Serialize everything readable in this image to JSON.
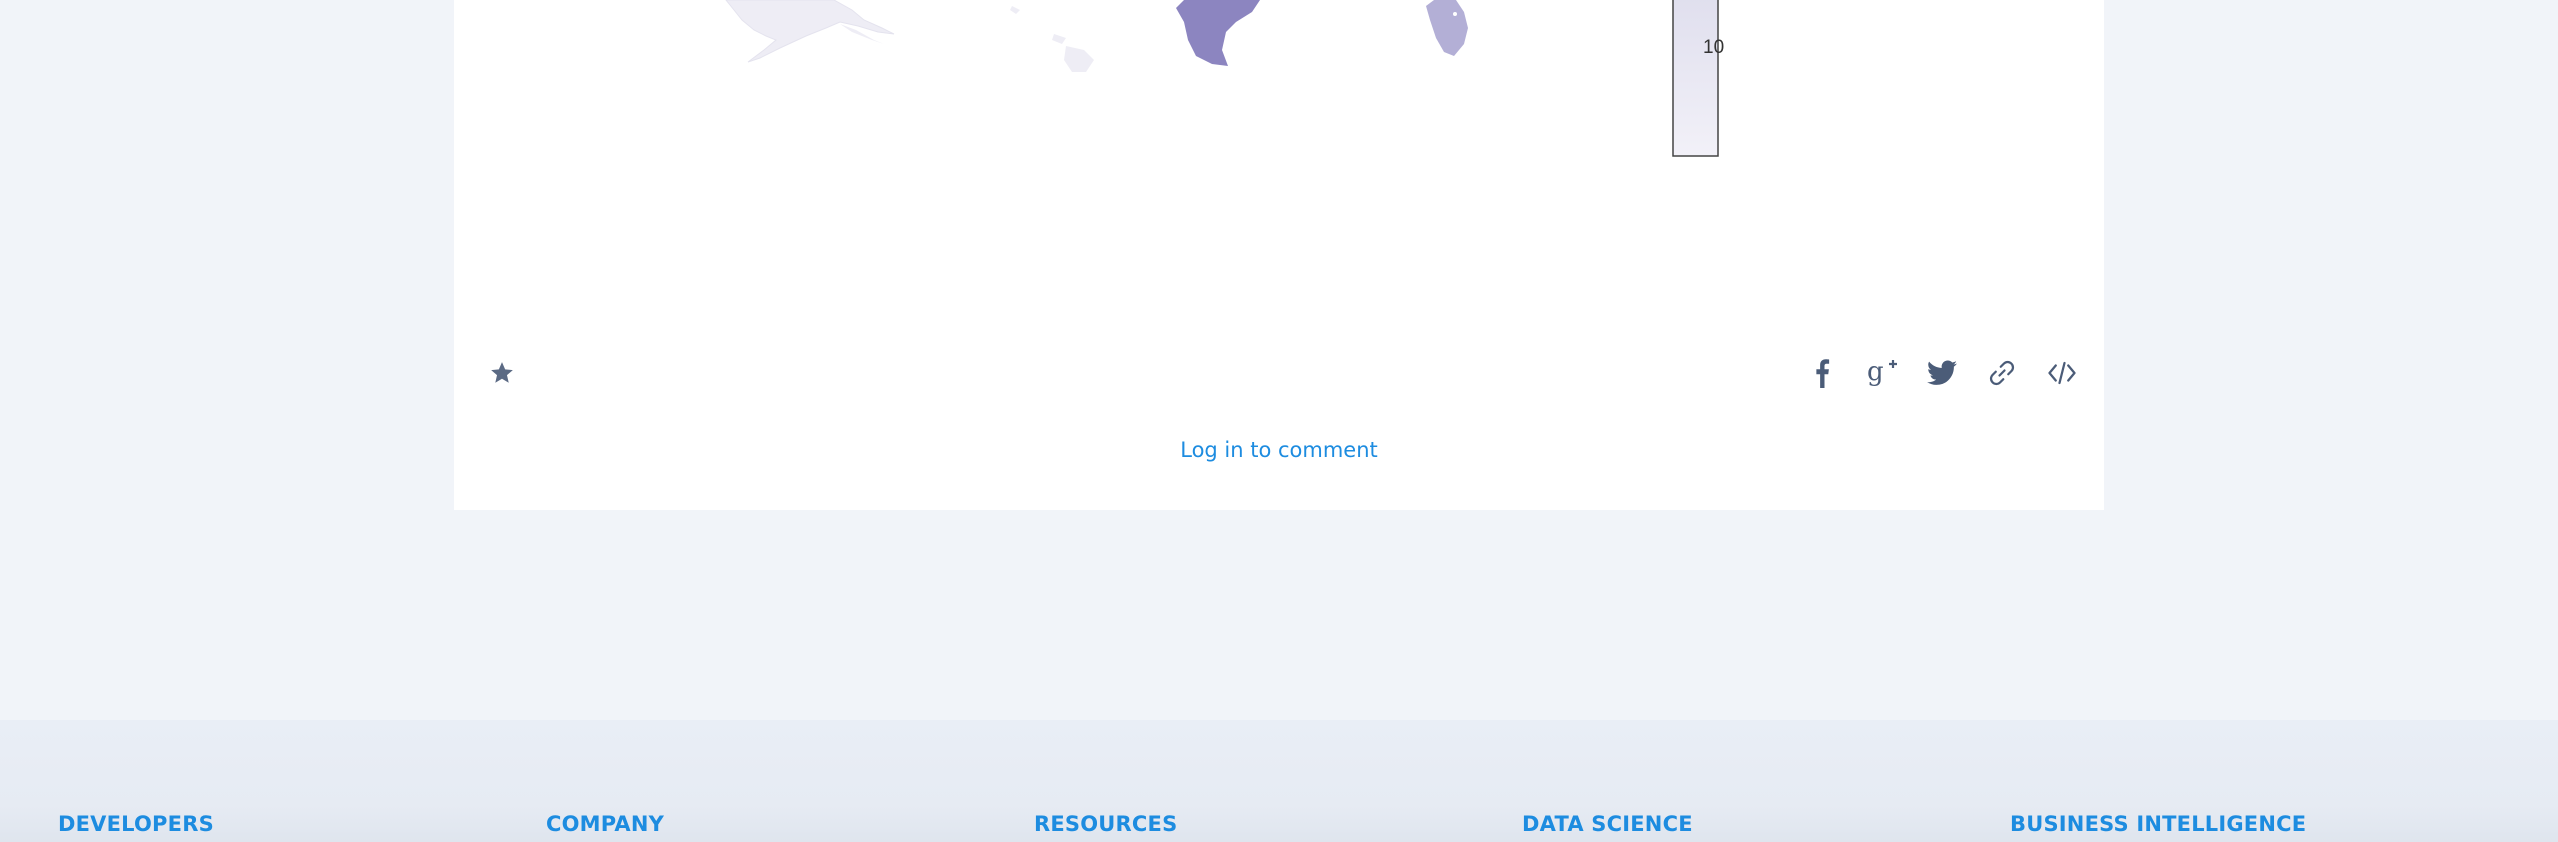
{
  "colorscale": {
    "tick_label": "10",
    "colors": [
      "#8c85c0",
      "#b3afd6",
      "#e6e6f1",
      "#f1f0f7"
    ]
  },
  "actions": {
    "star_icon": "star-icon",
    "share_icons": [
      "facebook-icon",
      "google-plus-icon",
      "twitter-icon",
      "link-icon",
      "embed-code-icon"
    ]
  },
  "comment": {
    "login_text": "Log in to comment"
  },
  "footer": {
    "columns": [
      "DEVELOPERS",
      "COMPANY",
      "RESOURCES",
      "DATA SCIENCE",
      "BUSINESS INTELLIGENCE"
    ]
  }
}
